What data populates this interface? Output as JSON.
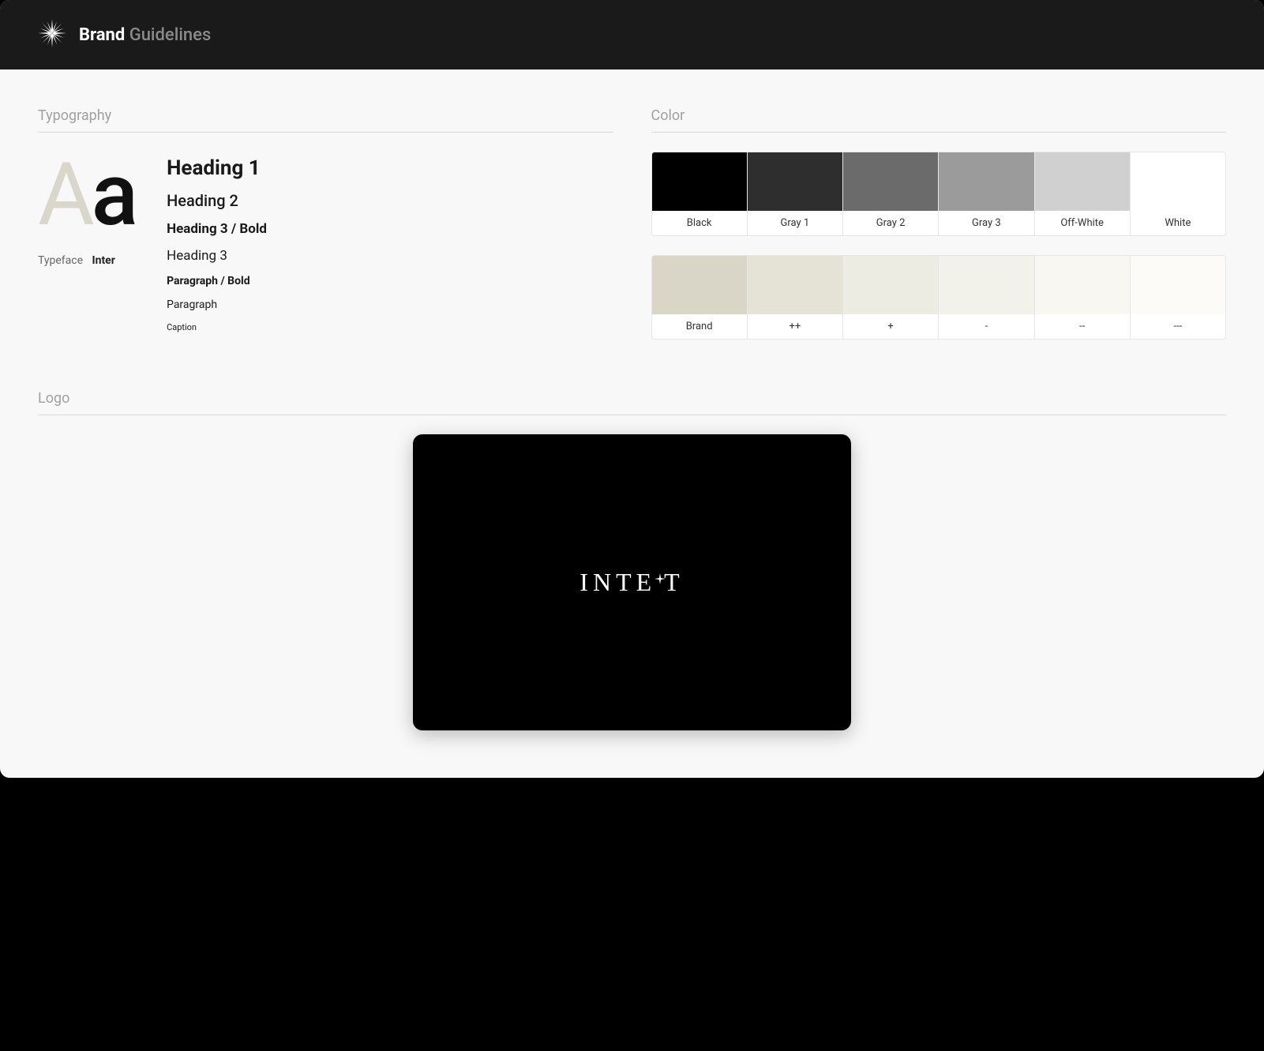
{
  "header": {
    "title_bold": "Brand",
    "title_light": "Guidelines"
  },
  "sections": {
    "typography": "Typography",
    "color": "Color",
    "logo": "Logo"
  },
  "typography": {
    "sample_glyph_1": "A",
    "sample_glyph_2": "a",
    "typeface_label": "Typeface",
    "typeface_value": "Inter",
    "styles": {
      "h1": "Heading 1",
      "h2": "Heading 2",
      "h3_bold": "Heading 3 / Bold",
      "h3": "Heading 3",
      "p_bold": "Paragraph / Bold",
      "p": "Paragraph",
      "caption": "Caption"
    }
  },
  "colors": {
    "grays": [
      {
        "name": "Black",
        "hex": "#000000"
      },
      {
        "name": "Gray 1",
        "hex": "#2e2e2e"
      },
      {
        "name": "Gray 2",
        "hex": "#6b6b6b"
      },
      {
        "name": "Gray 3",
        "hex": "#9b9b9b"
      },
      {
        "name": "Off-White",
        "hex": "#d0d0d0"
      },
      {
        "name": "White",
        "hex": "#ffffff"
      }
    ],
    "brand": [
      {
        "name": "Brand",
        "hex": "#d9d6c7"
      },
      {
        "name": "++",
        "hex": "#e5e3d6"
      },
      {
        "name": "+",
        "hex": "#edece2"
      },
      {
        "name": "-",
        "hex": "#f3f2ea"
      },
      {
        "name": "--",
        "hex": "#f8f7f1"
      },
      {
        "name": "---",
        "hex": "#fcfbf7"
      }
    ]
  },
  "logo": {
    "text_1": "INTE",
    "text_2": "T",
    "brand_name": "INTECT"
  }
}
